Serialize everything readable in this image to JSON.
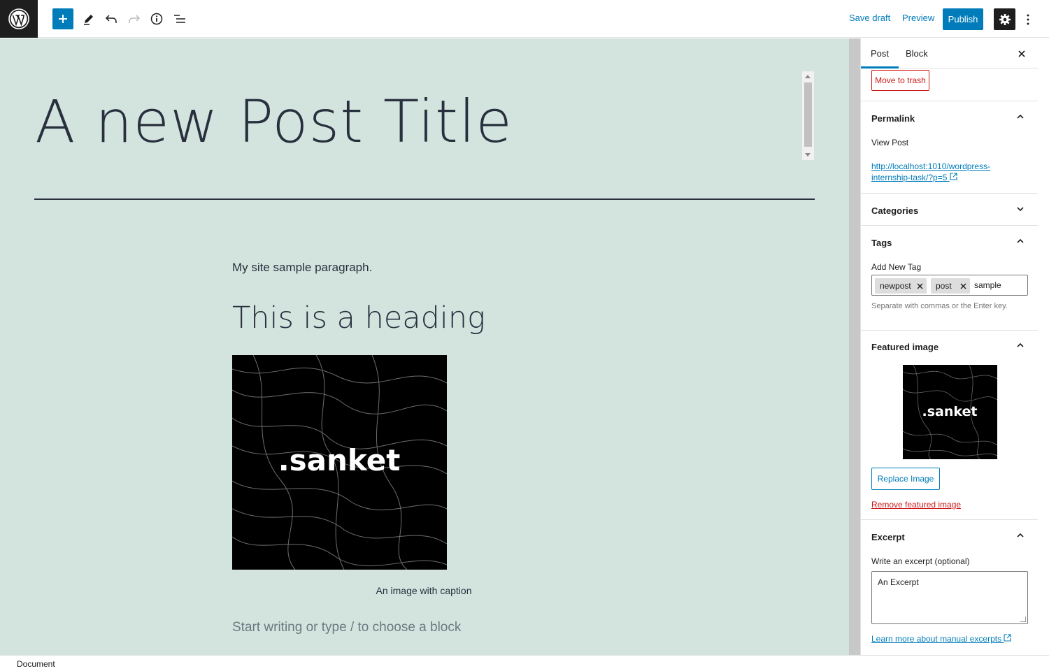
{
  "toolbar": {
    "save_draft": "Save draft",
    "preview": "Preview",
    "publish": "Publish"
  },
  "editor": {
    "post_title": "A new Post Title",
    "paragraph": "My site sample paragraph.",
    "heading": "This is a heading",
    "image_text": ".sanket",
    "image_caption": "An image with caption",
    "appender_placeholder": "Start writing or type / to choose a block"
  },
  "sidebar": {
    "tabs": [
      "Post",
      "Block"
    ],
    "trash_button": "Move to trash",
    "permalink": {
      "title": "Permalink",
      "label": "View Post",
      "url_line1": "http://localhost:1010/wordpress-",
      "url_line2": "internship-task/?p=5"
    },
    "categories": {
      "title": "Categories"
    },
    "tags": {
      "title": "Tags",
      "label": "Add New Tag",
      "chips": [
        "newpost",
        "post"
      ],
      "input_value": "sample",
      "help": "Separate with commas or the Enter key."
    },
    "featured_image": {
      "title": "Featured image",
      "image_text": ".sanket",
      "replace_button": "Replace Image",
      "remove_link": "Remove featured image"
    },
    "excerpt": {
      "title": "Excerpt",
      "label": "Write an excerpt (optional)",
      "value": "An Excerpt",
      "learn_more": "Learn more about manual excerpts"
    }
  },
  "footer": {
    "breadcrumb": "Document"
  },
  "colors": {
    "accent": "#007cba",
    "canvas_bg": "#d3e4df",
    "danger": "#cc1818",
    "text_dark": "#28303d"
  }
}
